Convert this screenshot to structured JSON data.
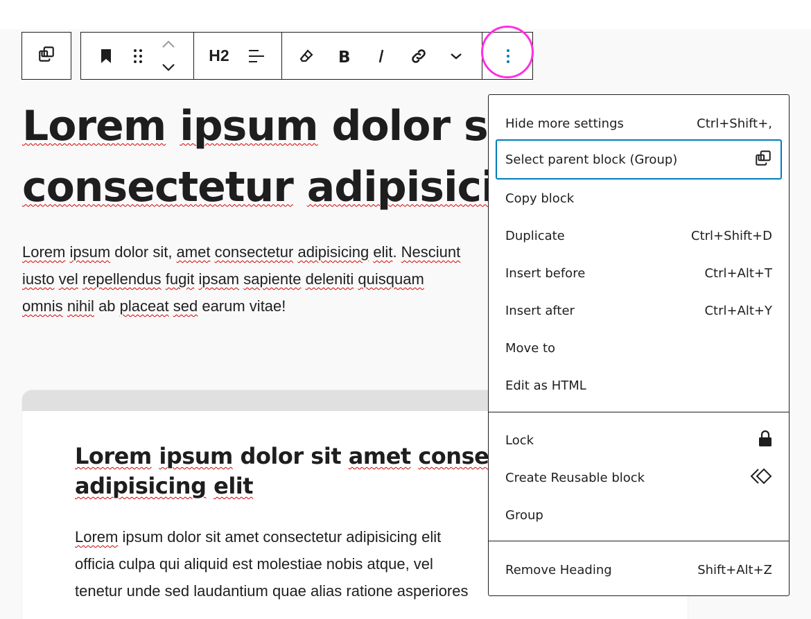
{
  "toolbar": {
    "parent_icon": "select-parent-icon",
    "buttons": [
      {
        "name": "bookmark-icon"
      },
      {
        "name": "drag-handle-icon"
      },
      {
        "name": "move-up-icon"
      },
      {
        "name": "move-down-icon"
      },
      {
        "name": "heading-level",
        "label": "H2"
      },
      {
        "name": "align-left-icon"
      },
      {
        "name": "eraser-icon"
      },
      {
        "name": "bold-icon"
      },
      {
        "name": "italic-icon"
      },
      {
        "name": "link-icon"
      },
      {
        "name": "chevron-down-icon"
      },
      {
        "name": "more-options-icon"
      }
    ],
    "heading_level": "H2",
    "highlight_color": "#ff2fe2"
  },
  "content": {
    "heading1": {
      "line1": [
        "Lorem",
        " ",
        "ipsum",
        " ",
        "dolor",
        " ",
        "sit"
      ],
      "line2": [
        "consectetur",
        " ",
        "adipisicing"
      ]
    },
    "para1": {
      "line1": [
        "Lorem",
        " ",
        "ipsum",
        " dolor sit, ",
        "amet",
        " ",
        "consectetur",
        " ",
        "adipisicing",
        " ",
        "elit",
        ". ",
        "Nesciunt"
      ],
      "line2": [
        "iusto",
        " ",
        "vel",
        " ",
        "repellendus",
        " ",
        "fugit",
        " ",
        "ipsam",
        " ",
        "sapiente",
        " ",
        "deleniti",
        " ",
        "quisquam"
      ],
      "line3": [
        "omnis",
        " ",
        "nihil",
        " ab ",
        "placeat",
        " ",
        "sed",
        " earum vitae!"
      ]
    },
    "card": {
      "heading2_line1": [
        "Lorem",
        " ",
        "ipsum",
        " dolor sit ",
        "amet",
        " ",
        "consectetur"
      ],
      "heading2_line2": [
        "adipisicing",
        " ",
        "elit"
      ],
      "para_line1": [
        "Lorem",
        " ipsum dolor sit amet consectetur adipisicing elit"
      ],
      "para_line2": "officia culpa qui aliquid est molestiae nobis atque, vel",
      "para_line3": "tenetur unde sed laudantium quae alias ratione asperiores"
    }
  },
  "menu": {
    "items": [
      {
        "label": "Hide more settings",
        "shortcut": "Ctrl+Shift+,"
      },
      {
        "label": "Select parent block (Group)",
        "icon": "select-parent-icon",
        "active": true
      },
      {
        "label": "Copy block"
      },
      {
        "label": "Duplicate",
        "shortcut": "Ctrl+Shift+D"
      },
      {
        "label": "Insert before",
        "shortcut": "Ctrl+Alt+T"
      },
      {
        "label": "Insert after",
        "shortcut": "Ctrl+Alt+Y"
      },
      {
        "label": "Move to"
      },
      {
        "label": "Edit as HTML"
      },
      {
        "label": "Lock",
        "icon": "lock-icon"
      },
      {
        "label": "Create Reusable block",
        "icon": "reusable-block-icon"
      },
      {
        "label": "Group"
      },
      {
        "label": "Remove Heading",
        "shortcut": "Shift+Alt+Z"
      }
    ],
    "active_border_color": "#007cba"
  },
  "colors": {
    "spellcheck_underline": "#d40000",
    "text": "#1e1e1e",
    "background": "#f9f9f9",
    "card_header": "#e0e0e0"
  }
}
